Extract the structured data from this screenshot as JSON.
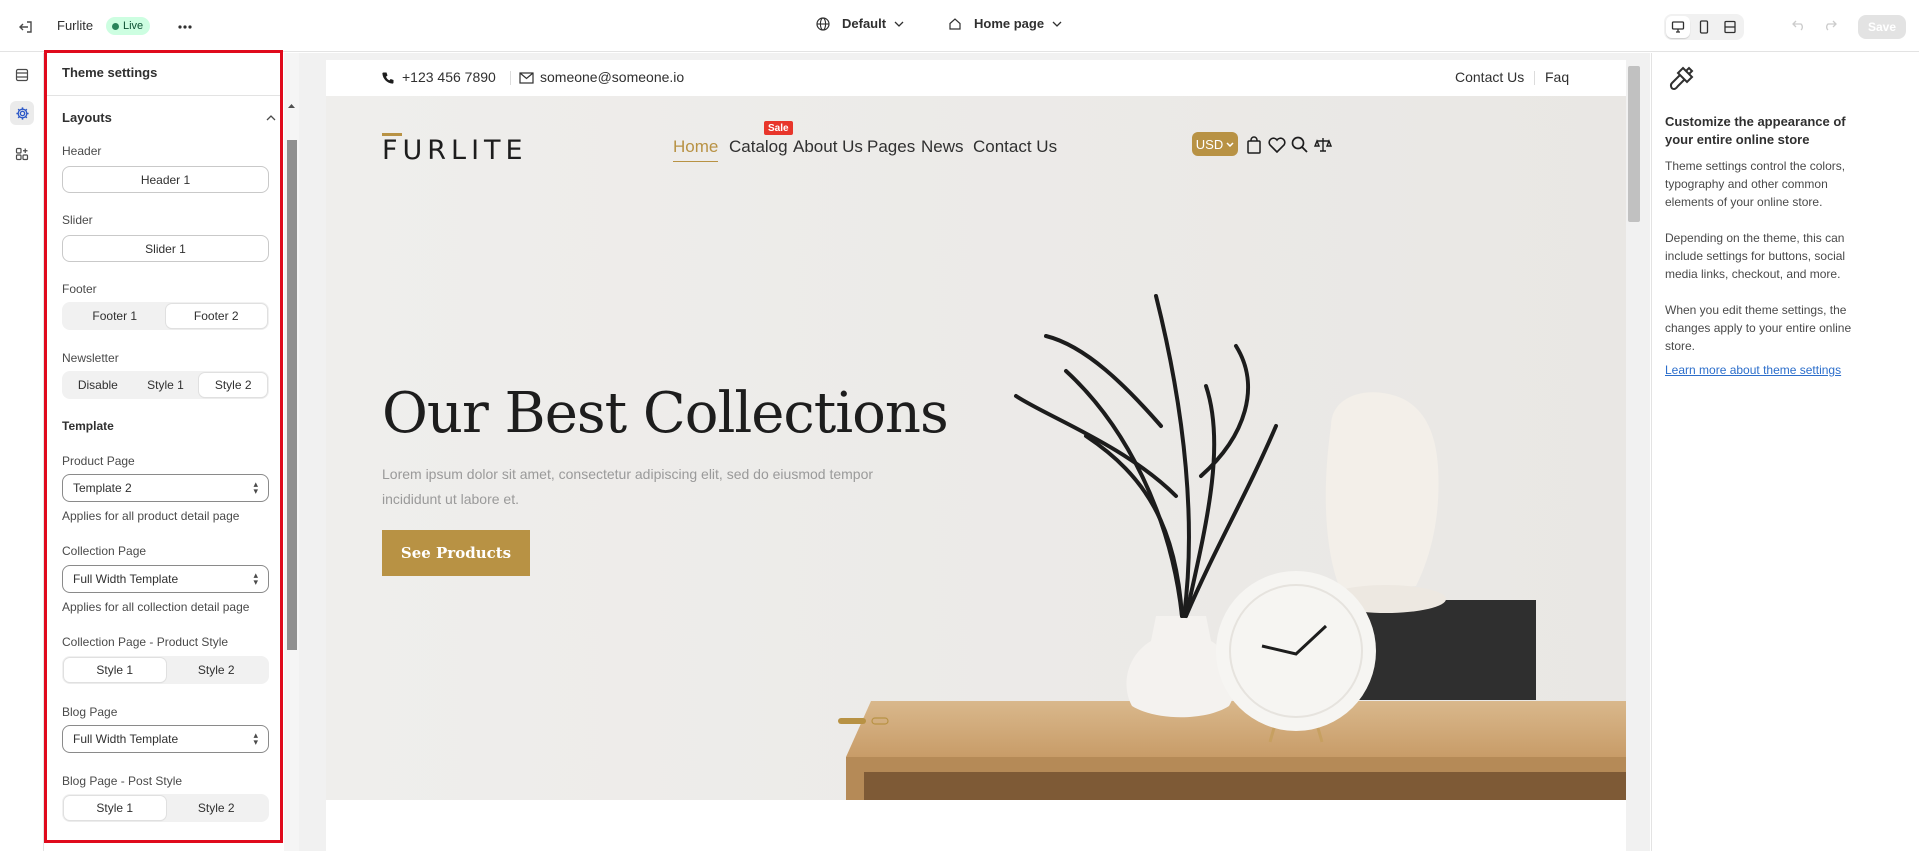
{
  "topbar": {
    "store_name": "Furlite",
    "status_badge": "Live",
    "theme_selector": "Default",
    "page_selector": "Home page",
    "save_label": "Save"
  },
  "left_panel": {
    "title": "Theme settings",
    "section_layouts": "Layouts",
    "header_label": "Header",
    "header_value": "Header 1",
    "slider_label": "Slider",
    "slider_value": "Slider 1",
    "footer_label": "Footer",
    "footer_options": [
      "Footer 1",
      "Footer 2"
    ],
    "footer_selected": "Footer 2",
    "newsletter_label": "Newsletter",
    "newsletter_options": [
      "Disable",
      "Style 1",
      "Style 2"
    ],
    "newsletter_selected": "Style 2",
    "template_heading": "Template",
    "product_page_label": "Product Page",
    "product_page_value": "Template 2",
    "product_page_help": "Applies for all product detail page",
    "collection_page_label": "Collection Page",
    "collection_page_value": "Full Width Template",
    "collection_page_help": "Applies for all collection detail page",
    "collection_style_label": "Collection Page - Product Style",
    "collection_style_options": [
      "Style 1",
      "Style 2"
    ],
    "collection_style_selected": "Style 1",
    "blog_page_label": "Blog Page",
    "blog_page_value": "Full Width Template",
    "blog_post_style_label": "Blog Page - Post Style",
    "blog_post_style_options": [
      "Style 1",
      "Style 2"
    ],
    "blog_post_style_selected": "Style 1"
  },
  "store": {
    "phone": "+123 456 7890",
    "email": "someone@someone.io",
    "top_links": [
      "Contact Us",
      "Faq"
    ],
    "logo": "FURLITE",
    "nav": [
      "Home",
      "Catalog",
      "About Us",
      "Pages",
      "News",
      "Contact Us"
    ],
    "nav_active": "Home",
    "sale_badge": "Sale",
    "currency": "USD",
    "hero_title": "Our Best Collections",
    "hero_text": "Lorem ipsum dolor sit amet, consectetur adipiscing elit, sed do eiusmod tempor incididunt ut labore et.",
    "hero_button": "See Products",
    "accent_color": "#b89244"
  },
  "right_panel": {
    "heading": "Customize the appearance of your entire online store",
    "para1": "Theme settings control the colors, typography and other common elements of your online store.",
    "para2": "Depending on the theme, this can include settings for buttons, social media links, checkout, and more.",
    "para3": "When you edit theme settings, the changes apply to your entire online store.",
    "link": "Learn more about theme settings"
  },
  "icons": {
    "exit": "exit-icon",
    "more": "more-icon",
    "globe": "globe-icon",
    "home": "home-icon",
    "inspector": "inspector-icon",
    "desktop": "desktop-icon",
    "mobile": "mobile-icon",
    "fullscreen": "fullscreen-icon",
    "undo": "undo-icon",
    "redo": "redo-icon",
    "sections": "sections-icon",
    "settings": "settings-icon",
    "apps": "apps-icon",
    "paintbrush": "paintbrush-icon"
  }
}
